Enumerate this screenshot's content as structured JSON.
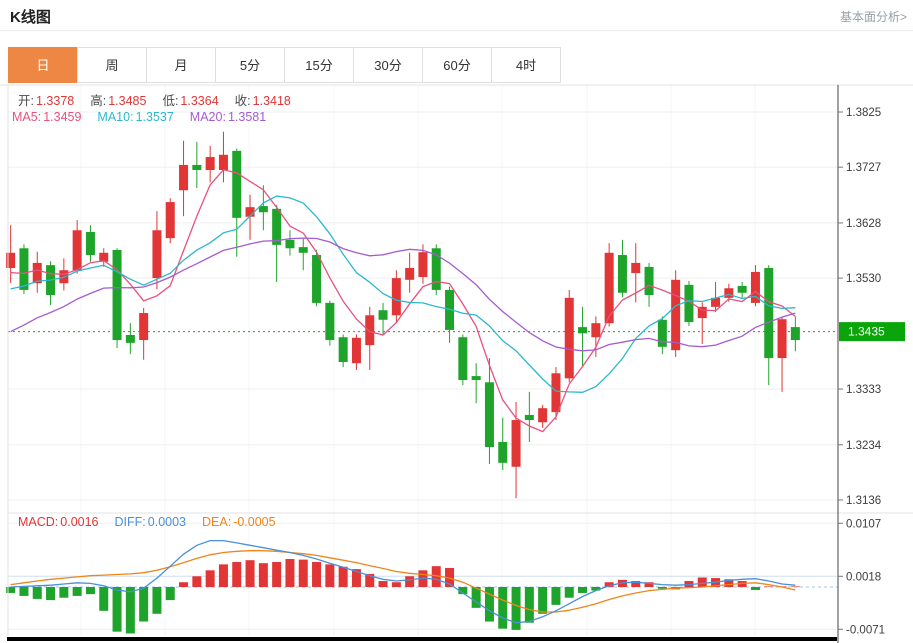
{
  "header": {
    "title": "K线图",
    "link_label": "基本面分析>"
  },
  "tabs": {
    "active": 0,
    "items": [
      "日",
      "周",
      "月",
      "5分",
      "15分",
      "30分",
      "60分",
      "4时"
    ]
  },
  "ohlc": {
    "label_color": "#4a4a4a",
    "value_color": "#e23535",
    "items": [
      {
        "label": "开:",
        "value": "1.3378"
      },
      {
        "label": "高:",
        "value": "1.3485"
      },
      {
        "label": "低:",
        "value": "1.3364"
      },
      {
        "label": "收:",
        "value": "1.3418"
      }
    ]
  },
  "ma_row": {
    "items": [
      {
        "label": "MA5:",
        "value": "1.3459",
        "color": "#e8517e"
      },
      {
        "label": "MA10:",
        "value": "1.3537",
        "color": "#2cb8cc"
      },
      {
        "label": "MA20:",
        "value": "1.3581",
        "color": "#a55bd0"
      }
    ]
  },
  "macd_row": {
    "items": [
      {
        "label": "MACD:",
        "value": "0.0016",
        "color": "#e23535"
      },
      {
        "label": "DIFF:",
        "value": "0.0003",
        "color": "#4a90d9"
      },
      {
        "label": "DEA:",
        "value": "-0.0005",
        "color": "#f08519"
      }
    ]
  },
  "colors": {
    "up": "#e23535",
    "down": "#1fa42b",
    "ma5": "#e8517e",
    "ma10": "#2cb8cc",
    "ma20": "#a55bd0",
    "diff": "#4a90d9",
    "dea": "#f08519",
    "price_line": "#2aa12a",
    "price_tag_bg": "#0aa50a",
    "price_tag_text": "#ffffff",
    "grid": "#efefef",
    "vgrid": "#f0f4f7",
    "grid_blue": "#cfe0ef",
    "zero_dash": "#9fc3e8",
    "separator": "#e3e3e3",
    "axis_border": "#444444",
    "tick_text": "#3c3c3c",
    "scrollbar": "#000000"
  },
  "chart_data": {
    "type": "candlestick+macd",
    "title": "K线图",
    "y_axis": {
      "ticks": [
        {
          "v": 1.3825,
          "label": "1.3825"
        },
        {
          "v": 1.3727,
          "label": "1.3727"
        },
        {
          "v": 1.3628,
          "label": "1.3628"
        },
        {
          "v": 1.353,
          "label": "1.3530"
        },
        {
          "v": 1.3333,
          "label": "1.3333"
        },
        {
          "v": 1.3234,
          "label": "1.3234"
        },
        {
          "v": 1.3136,
          "label": "1.3136"
        }
      ],
      "current_price": 1.3435,
      "current_label": "1.3435"
    },
    "macd_axis": {
      "ticks": [
        {
          "v": 0.0107,
          "label": "0.0107"
        },
        {
          "v": 0.0018,
          "label": "0.0018"
        },
        {
          "v": -0.0071,
          "label": "-0.0071"
        }
      ]
    },
    "candles": [
      [
        1.3548,
        1.3624,
        1.3521,
        1.3575
      ],
      [
        1.3583,
        1.359,
        1.3502,
        1.3509
      ],
      [
        1.3521,
        1.3577,
        1.3504,
        1.3557
      ],
      [
        1.3553,
        1.356,
        1.3482,
        1.35
      ],
      [
        1.3521,
        1.3565,
        1.3508,
        1.3544
      ],
      [
        1.3544,
        1.3633,
        1.3538,
        1.3615
      ],
      [
        1.3612,
        1.3624,
        1.3559,
        1.3571
      ],
      [
        1.3559,
        1.3583,
        1.355,
        1.3575
      ],
      [
        1.358,
        1.3583,
        1.3406,
        1.342
      ],
      [
        1.3429,
        1.345,
        1.3395,
        1.3415
      ],
      [
        1.342,
        1.3477,
        1.3385,
        1.3468
      ],
      [
        1.353,
        1.3649,
        1.351,
        1.3615
      ],
      [
        1.3601,
        1.3672,
        1.3592,
        1.3665
      ],
      [
        1.3686,
        1.3774,
        1.364,
        1.3731
      ],
      [
        1.3731,
        1.3772,
        1.369,
        1.3722
      ],
      [
        1.3722,
        1.3765,
        1.37,
        1.3745
      ],
      [
        1.3722,
        1.379,
        1.37,
        1.3749
      ],
      [
        1.3756,
        1.376,
        1.3568,
        1.3637
      ],
      [
        1.3639,
        1.3678,
        1.3598,
        1.3656
      ],
      [
        1.3658,
        1.3695,
        1.3615,
        1.3647
      ],
      [
        1.3653,
        1.366,
        1.3523,
        1.3589
      ],
      [
        1.3598,
        1.3615,
        1.357,
        1.3583
      ],
      [
        1.3585,
        1.36,
        1.3544,
        1.3575
      ],
      [
        1.3571,
        1.358,
        1.348,
        1.3486
      ],
      [
        1.3486,
        1.349,
        1.341,
        1.342
      ],
      [
        1.3425,
        1.343,
        1.3372,
        1.3381
      ],
      [
        1.3379,
        1.343,
        1.3367,
        1.3424
      ],
      [
        1.3411,
        1.3479,
        1.3367,
        1.3464
      ],
      [
        1.3473,
        1.3486,
        1.343,
        1.3456
      ],
      [
        1.3464,
        1.3544,
        1.345,
        1.353
      ],
      [
        1.3527,
        1.3575,
        1.3504,
        1.3548
      ],
      [
        1.3532,
        1.359,
        1.352,
        1.3576
      ],
      [
        1.3583,
        1.359,
        1.35,
        1.3509
      ],
      [
        1.3509,
        1.3515,
        1.3415,
        1.3438
      ],
      [
        1.3425,
        1.343,
        1.334,
        1.3349
      ],
      [
        1.3356,
        1.3379,
        1.3308,
        1.3349
      ],
      [
        1.3345,
        1.3388,
        1.32,
        1.323
      ],
      [
        1.3239,
        1.3282,
        1.3189,
        1.3202
      ],
      [
        1.3195,
        1.331,
        1.3139,
        1.3278
      ],
      [
        1.3287,
        1.3328,
        1.3239,
        1.3278
      ],
      [
        1.3274,
        1.3305,
        1.3264,
        1.3299
      ],
      [
        1.3292,
        1.3372,
        1.3278,
        1.3361
      ],
      [
        1.3352,
        1.3509,
        1.3345,
        1.3495
      ],
      [
        1.3443,
        1.3479,
        1.3372,
        1.3432
      ],
      [
        1.3425,
        1.3462,
        1.339,
        1.345
      ],
      [
        1.345,
        1.3592,
        1.3444,
        1.3575
      ],
      [
        1.3571,
        1.3598,
        1.3496,
        1.3504
      ],
      [
        1.3539,
        1.3592,
        1.3487,
        1.3557
      ],
      [
        1.355,
        1.3557,
        1.3479,
        1.35
      ],
      [
        1.3456,
        1.3462,
        1.3395,
        1.3408
      ],
      [
        1.3402,
        1.3544,
        1.339,
        1.3527
      ],
      [
        1.3518,
        1.3525,
        1.3445,
        1.3452
      ],
      [
        1.3459,
        1.3487,
        1.3413,
        1.3479
      ],
      [
        1.3479,
        1.3523,
        1.347,
        1.3495
      ],
      [
        1.3495,
        1.352,
        1.3488,
        1.3512
      ],
      [
        1.3516,
        1.3523,
        1.3495,
        1.3504
      ],
      [
        1.3486,
        1.3553,
        1.348,
        1.3541
      ],
      [
        1.3548,
        1.3553,
        1.334,
        1.3388
      ],
      [
        1.3388,
        1.346,
        1.3328,
        1.3457
      ],
      [
        1.3443,
        1.3462,
        1.34,
        1.342
      ]
    ],
    "ma_seed": [
      1.326,
      1.3278,
      1.3296,
      1.3314,
      1.3332,
      1.335,
      1.3368,
      1.3386,
      1.3404,
      1.3422,
      1.344,
      1.3458,
      1.347,
      1.3482,
      1.3494,
      1.3506,
      1.3516,
      1.3526,
      1.3536,
      1.3546
    ],
    "ma_periods": [
      5,
      10,
      20
    ],
    "macd": {
      "hist": [
        -0.001,
        -0.0015,
        -0.002,
        -0.0022,
        -0.0018,
        -0.0015,
        -0.0012,
        -0.004,
        -0.0075,
        -0.0078,
        -0.0058,
        -0.0045,
        -0.0022,
        0.0008,
        0.0018,
        0.0028,
        0.0038,
        0.0042,
        0.0045,
        0.004,
        0.0042,
        0.0047,
        0.0046,
        0.0042,
        0.0038,
        0.0034,
        0.003,
        0.0022,
        0.001,
        0.0008,
        0.0018,
        0.0028,
        0.0035,
        0.0032,
        -0.0012,
        -0.0035,
        -0.0058,
        -0.007,
        -0.0072,
        -0.006,
        -0.0045,
        -0.003,
        -0.0018,
        -0.001,
        -0.0006,
        0.0008,
        0.0012,
        0.001,
        0.0008,
        -0.0003,
        -0.0004,
        0.001,
        0.0016,
        0.0015,
        0.0013,
        0.001,
        -0.0005,
        0.0001,
        0.0001,
        0.0001
      ],
      "diff": [
        0.0,
        0.0001,
        0.0002,
        0.0003,
        0.0005,
        0.0007,
        0.0006,
        0.0002,
        -0.0005,
        -0.0008,
        -0.0002,
        0.0015,
        0.0035,
        0.0055,
        0.007,
        0.0078,
        0.0078,
        0.0074,
        0.007,
        0.0066,
        0.0062,
        0.0058,
        0.0053,
        0.0047,
        0.004,
        0.0033,
        0.0026,
        0.0019,
        0.0013,
        0.001,
        0.0012,
        0.0015,
        0.0013,
        0.0005,
        -0.001,
        -0.0025,
        -0.004,
        -0.0052,
        -0.006,
        -0.0058,
        -0.005,
        -0.004,
        -0.0028,
        -0.0016,
        -0.0006,
        0.0002,
        0.0007,
        0.0008,
        0.0006,
        0.0004,
        0.0003,
        0.0004,
        0.0006,
        0.0008,
        0.0011,
        0.0013,
        0.0014,
        0.001,
        0.0005,
        0.0003
      ],
      "dea": [
        0.0004,
        0.0007,
        0.001,
        0.0013,
        0.0015,
        0.0017,
        0.0019,
        0.002,
        0.0021,
        0.0022,
        0.0024,
        0.0028,
        0.0034,
        0.0041,
        0.0048,
        0.0054,
        0.0058,
        0.006,
        0.0061,
        0.0061,
        0.006,
        0.0058,
        0.0056,
        0.0053,
        0.0049,
        0.0045,
        0.0041,
        0.0036,
        0.0031,
        0.0026,
        0.0023,
        0.0021,
        0.0019,
        0.0015,
        0.0008,
        -0.0002,
        -0.0012,
        -0.0022,
        -0.0031,
        -0.0038,
        -0.0042,
        -0.0042,
        -0.0039,
        -0.0034,
        -0.0028,
        -0.0021,
        -0.0015,
        -0.001,
        -0.0006,
        -0.0004,
        -0.0002,
        -0.0001,
        0.0,
        0.0002,
        0.0004,
        0.0006,
        0.0007,
        0.0004,
        0.0,
        -0.0005
      ]
    }
  }
}
